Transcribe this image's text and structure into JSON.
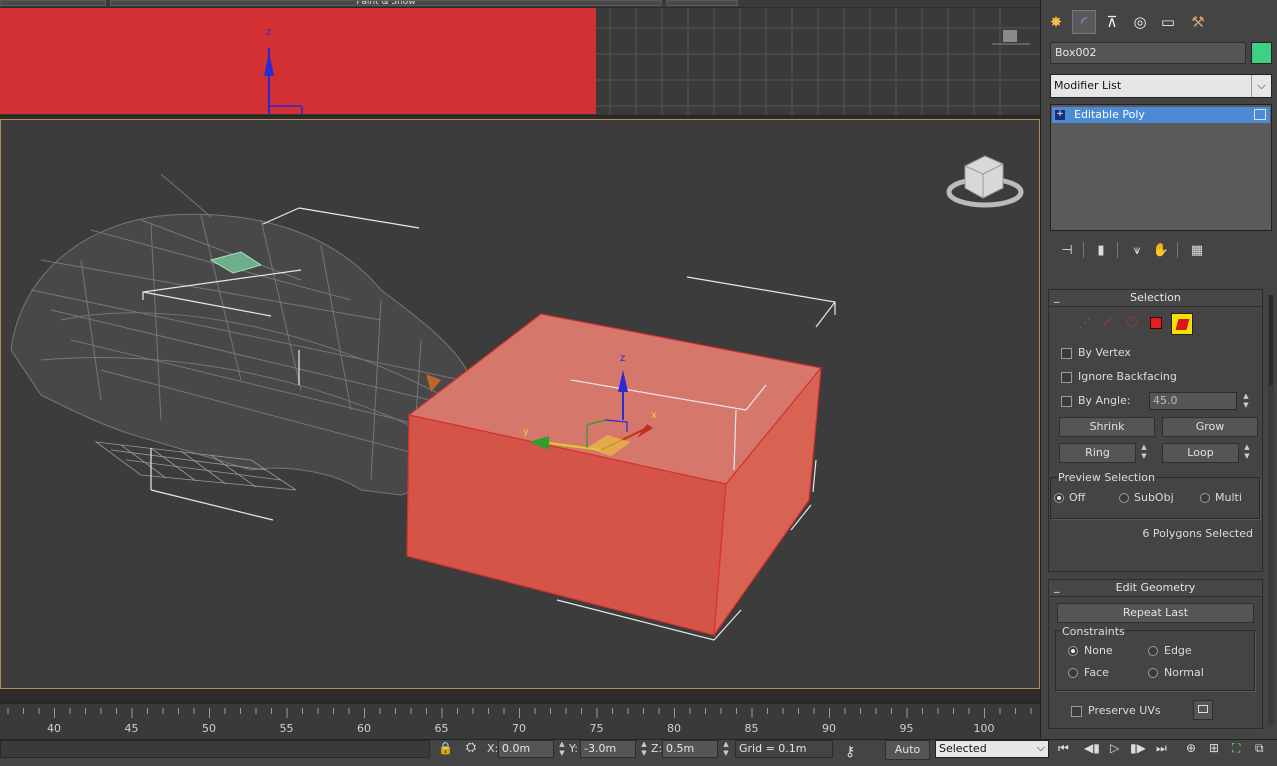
{
  "top_tab_label": "Paint & Snow",
  "viewports": {
    "top": {
      "axis_z": "z"
    },
    "perspective": {
      "gizmo_z": "z",
      "gizmo_x": "x",
      "gizmo_y": "y"
    }
  },
  "command_panel": {
    "tabs": [
      {
        "name": "create-tab-icon",
        "glyph": "✸"
      },
      {
        "name": "modify-tab-icon",
        "glyph": "◜"
      },
      {
        "name": "hierarchy-tab-icon",
        "glyph": "⊼"
      },
      {
        "name": "motion-tab-icon",
        "glyph": "◎"
      },
      {
        "name": "display-tab-icon",
        "glyph": "▭"
      },
      {
        "name": "utilities-tab-icon",
        "glyph": "⚒"
      }
    ],
    "object_name": "Box002",
    "object_color": "#3ed183",
    "modifier_list_label": "Modifier List",
    "stack_item": "Editable Poly",
    "selection_rollout": {
      "title": "Selection",
      "by_vertex": "By Vertex",
      "ignore_backfacing": "Ignore Backfacing",
      "by_angle": "By Angle:",
      "by_angle_value": "45.0",
      "shrink": "Shrink",
      "grow": "Grow",
      "ring": "Ring",
      "loop": "Loop",
      "preview_selection": "Preview Selection",
      "preview_off": "Off",
      "preview_subobj": "SubObj",
      "preview_multi": "Multi",
      "selected_status": "6 Polygons Selected"
    },
    "edit_geometry_rollout": {
      "title": "Edit Geometry",
      "repeat_last": "Repeat Last",
      "constraints": "Constraints",
      "none": "None",
      "edge": "Edge",
      "face": "Face",
      "normal": "Normal",
      "preserve_uvs": "Preserve UVs"
    }
  },
  "timeline": {
    "ticks": [
      "40",
      "45",
      "50",
      "55",
      "60",
      "65",
      "70",
      "75",
      "80",
      "85",
      "90",
      "95",
      "100"
    ]
  },
  "status_bar": {
    "x_label": "X:",
    "x_value": "0.0m",
    "y_label": "Y:",
    "y_value": "-3.0m",
    "z_label": "Z:",
    "z_value": "0.5m",
    "grid": "Grid = 0.1m",
    "auto_key": "Auto",
    "selection_set": "Selected"
  }
}
